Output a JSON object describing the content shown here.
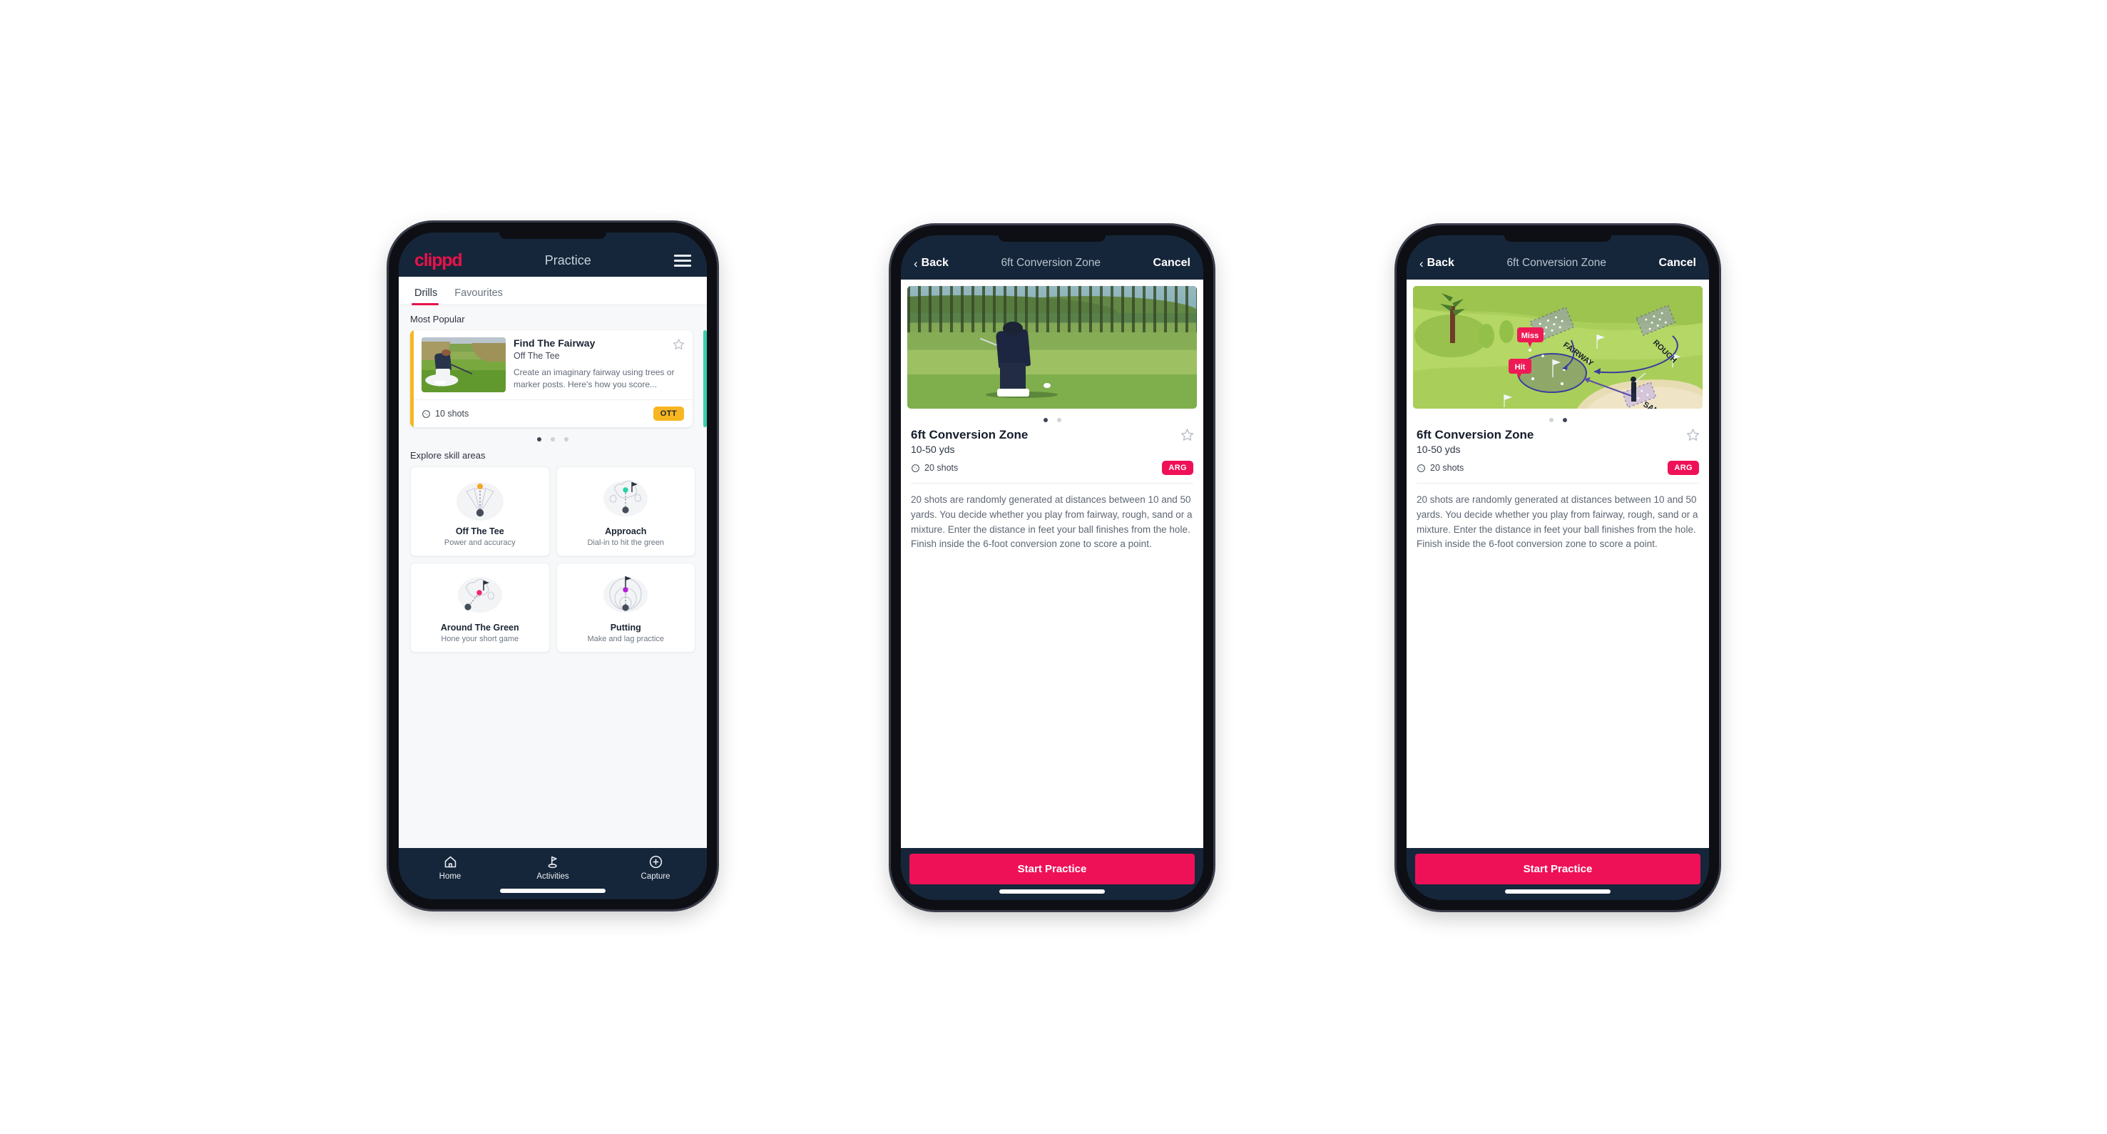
{
  "phone1": {
    "appbar": {
      "logo": "clippd",
      "title": "Practice",
      "menu_icon": "hamburger-icon"
    },
    "tabs": [
      {
        "label": "Drills",
        "active": true
      },
      {
        "label": "Favourites",
        "active": false
      }
    ],
    "most_popular": {
      "section_title": "Most Popular",
      "card": {
        "name": "Find The Fairway",
        "subtitle": "Off The Tee",
        "description": "Create an imaginary fairway using trees or marker posts. Here's how you score...",
        "shots": "10 shots",
        "badge": "OTT",
        "accent_color": "#f5b722",
        "badge_bg": "#f7b520",
        "next_card_accent": "#3ad0ad"
      },
      "dots": [
        true,
        false,
        false
      ]
    },
    "skills": {
      "section_title": "Explore skill areas",
      "items": [
        {
          "name": "Off The Tee",
          "desc": "Power and accuracy",
          "icon": "tee-dispersion-icon",
          "dot_color": "#f5a623"
        },
        {
          "name": "Approach",
          "desc": "Dial-in to hit the green",
          "icon": "approach-green-icon",
          "dot_color": "#26d3a5"
        },
        {
          "name": "Around The Green",
          "desc": "Hone your short game",
          "icon": "around-green-icon",
          "dot_color": "#f4256d"
        },
        {
          "name": "Putting",
          "desc": "Make and lag practice",
          "icon": "putting-rings-icon",
          "dot_color": "#b41fd6"
        }
      ]
    },
    "bottom_nav": [
      {
        "label": "Home",
        "icon": "home-icon",
        "active": false
      },
      {
        "label": "Activities",
        "icon": "golf-flag-icon",
        "active": true
      },
      {
        "label": "Capture",
        "icon": "plus-circle-icon",
        "active": false
      }
    ]
  },
  "phone2": {
    "nav": {
      "back": "Back",
      "title": "6ft Conversion Zone",
      "cancel": "Cancel",
      "back_icon": "chevron-left-icon"
    },
    "hero": "chipping-photo",
    "dots": [
      true,
      false
    ],
    "drill": {
      "name": "6ft Conversion Zone",
      "yards": "10-50 yds",
      "shots": "20 shots",
      "badge": "ARG",
      "badge_bg": "#ef1158",
      "description": "20 shots are randomly generated at distances between 10 and 50 yards. You decide whether you play from fairway, rough, sand or a mixture. Enter the distance in feet your ball finishes from the hole. Finish inside the 6-foot conversion zone to score a point."
    },
    "cta": "Start Practice",
    "cta_color": "#ef1158"
  },
  "phone3": {
    "nav": {
      "back": "Back",
      "title": "6ft Conversion Zone",
      "cancel": "Cancel",
      "back_icon": "chevron-left-icon"
    },
    "hero": "course-diagram",
    "diagram": {
      "zone_labels": [
        "FAIRWAY",
        "ROUGH",
        "SAND"
      ],
      "markers": [
        "Miss",
        "Hit"
      ],
      "marker_color": "#ef1a55"
    },
    "dots": [
      false,
      true
    ],
    "drill": {
      "name": "6ft Conversion Zone",
      "yards": "10-50 yds",
      "shots": "20 shots",
      "badge": "ARG",
      "badge_bg": "#ef1158",
      "description": "20 shots are randomly generated at distances between 10 and 50 yards. You decide whether you play from fairway, rough, sand or a mixture. Enter the distance in feet your ball finishes from the hole. Finish inside the 6-foot conversion zone to score a point."
    },
    "cta": "Start Practice",
    "cta_color": "#ef1158"
  }
}
